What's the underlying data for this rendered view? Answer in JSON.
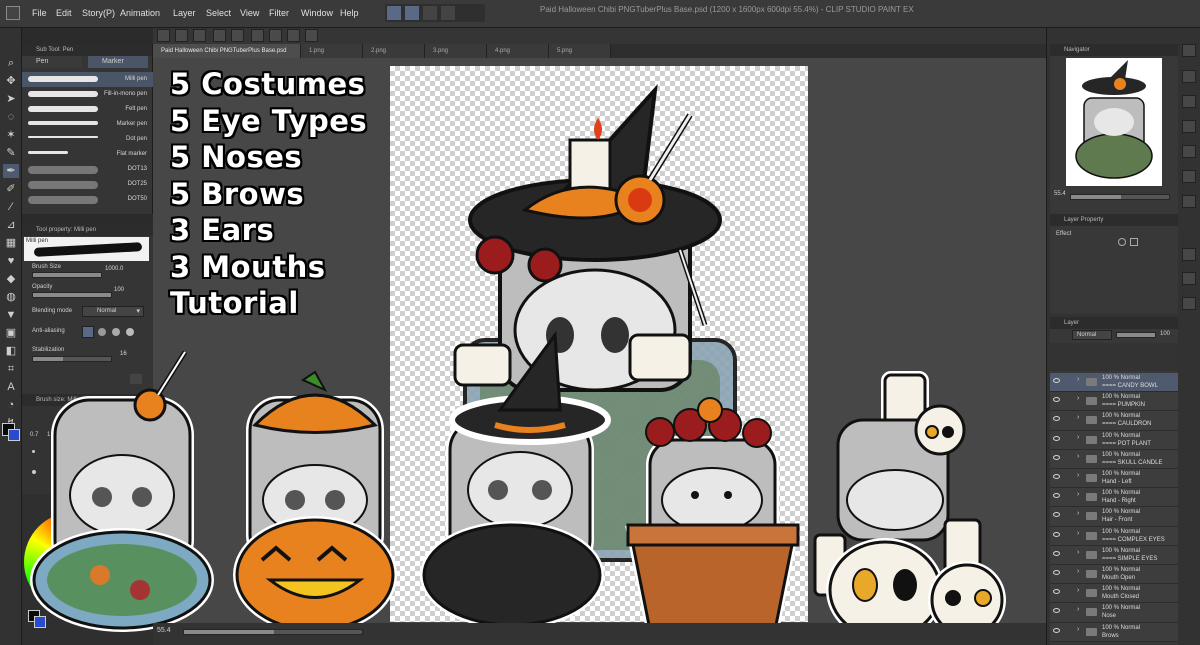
{
  "window": {
    "title": "Paid Halloween Chibi PNGTuberPlus Base.psd (1200 x 1600px 600dpi 55.4%) - CLIP STUDIO PAINT EX"
  },
  "menu": [
    "File",
    "Edit",
    "Story(P)",
    "Animation",
    "Layer",
    "Select",
    "View",
    "Filter",
    "Window",
    "Help"
  ],
  "subtool": {
    "header": "Sub Tool: Pen",
    "tabs": [
      "Pen",
      "Marker"
    ],
    "brushes": [
      "Milli pen",
      "Fill-in-mono pen",
      "Felt pen",
      "Marker pen",
      "Dot pen",
      "Flat marker",
      "DOT13",
      "DOT25",
      "DOT50"
    ]
  },
  "toolprop": {
    "header": "Tool property: Milli pen",
    "preview_label": "Milli pen",
    "brush_size_label": "Brush Size",
    "brush_size_value": "1000.0",
    "opacity_label": "Opacity",
    "opacity_value": "100",
    "blending_label": "Blending mode",
    "blending_value": "Normal",
    "antialias_label": "Anti-aliasing",
    "stabilization_label": "Stabilization",
    "stabilization_value": "16"
  },
  "brushsize": {
    "header": "Brush size: Milli pen",
    "values": [
      "0.7",
      "1"
    ]
  },
  "doc_tabs": [
    "Paid Halloween Chibi PNGTuberPlus Base.psd",
    "1.png",
    "2.png",
    "3.png",
    "4.png",
    "5.png"
  ],
  "status": {
    "zoom": "55.4"
  },
  "overlay": {
    "lines": [
      "5 Costumes",
      "5 Eye Types",
      "5 Noses",
      "5 Brows",
      "3 Ears",
      "3 Mouths",
      "Tutorial"
    ]
  },
  "navigator": {
    "header": "Navigator",
    "zoom": "55.4"
  },
  "layer_property": {
    "header": "Layer Property",
    "effect_label": "Effect"
  },
  "layer_panel": {
    "header": "Layer",
    "blend": "Normal",
    "opacity": "100",
    "layers": [
      {
        "line1": "100 % Normal",
        "line2": "==== CANDY BOWL",
        "selected": true
      },
      {
        "line1": "100 % Normal",
        "line2": "==== PUMPKIN"
      },
      {
        "line1": "100 % Normal",
        "line2": "==== CAULDRON"
      },
      {
        "line1": "100 % Normal",
        "line2": "==== POT PLANT"
      },
      {
        "line1": "100 % Normal",
        "line2": "==== SKULL CANDLE"
      },
      {
        "line1": "100 % Normal",
        "line2": "Hand - Left"
      },
      {
        "line1": "100 % Normal",
        "line2": "Hand - Right"
      },
      {
        "line1": "100 % Normal",
        "line2": "Hair - Front"
      },
      {
        "line1": "100 % Normal",
        "line2": "==== COMPLEX EYES"
      },
      {
        "line1": "100 % Normal",
        "line2": "==== SIMPLE EYES"
      },
      {
        "line1": "100 % Normal",
        "line2": "Mouth Open"
      },
      {
        "line1": "100 % Normal",
        "line2": "Mouth Closed"
      },
      {
        "line1": "100 % Normal",
        "line2": "Nose"
      },
      {
        "line1": "100 % Normal",
        "line2": "Brows"
      }
    ]
  },
  "colors": {
    "ui_bg": "#323232",
    "canvas_bg": "#474747",
    "selected_layer": "#4f5a6e",
    "pumpkin": "#e8821e",
    "hat": "#262626",
    "flower": "#9b1c1c",
    "skin": "#e7e7e7"
  }
}
